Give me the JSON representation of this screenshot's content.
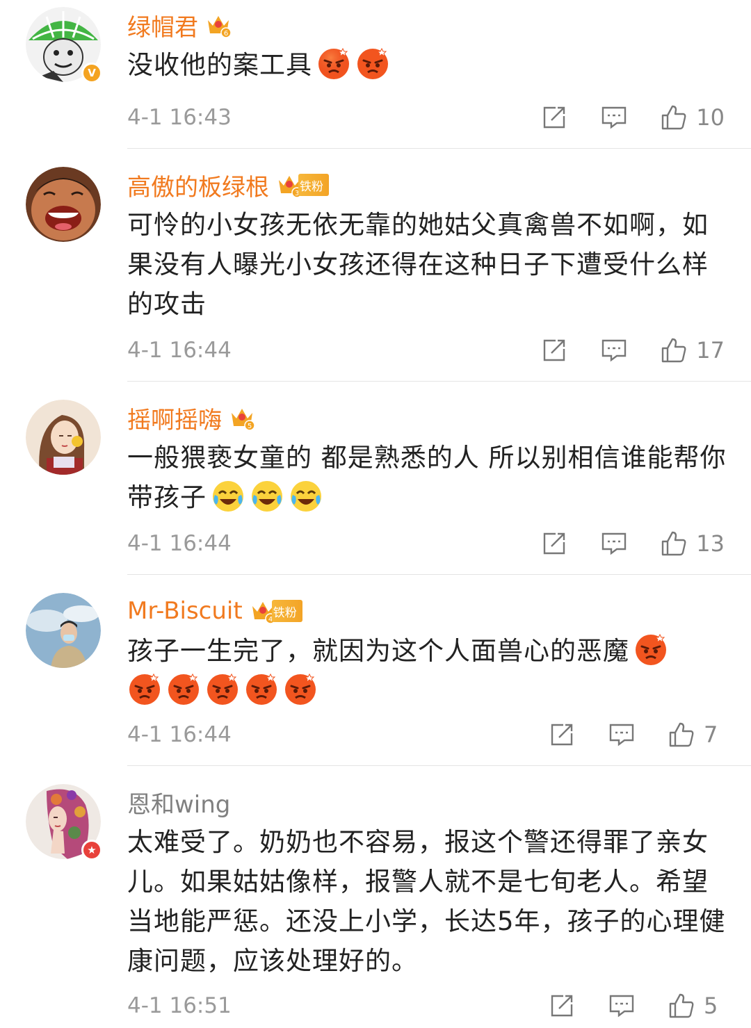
{
  "comments": [
    {
      "username": "绿帽君",
      "crown_level": "6",
      "fan_label": "",
      "text": "没收他的案工具",
      "emoji_count": 2,
      "emoji": "angry-face",
      "time": "4-1 16:43",
      "likes": "10",
      "avatar_badge": "v",
      "avatar_badge_label": "V",
      "avatar_badge_color": "#f4a321"
    },
    {
      "username": "高傲的板绿根",
      "crown_level": "3",
      "fan_label": "铁粉",
      "text": "可怜的小女孩无依无靠的她姑父真禽兽不如啊，如果没有人曝光小女孩还得在这种日子下遭受什么样的攻击",
      "emoji_count": 0,
      "emoji": "",
      "time": "4-1 16:44",
      "likes": "17"
    },
    {
      "username": "摇啊摇嗨",
      "crown_level": "5",
      "fan_label": "",
      "text": "一般猥亵女童的 都是熟悉的人 所以别相信谁能帮你带孩子",
      "emoji_count": 3,
      "emoji": "crying-laughing-face",
      "time": "4-1 16:44",
      "likes": "13"
    },
    {
      "username": "Mr-Biscuit",
      "crown_level": "4",
      "fan_label": "铁粉",
      "text": "孩子一生完了，就因为这个人面兽心的恶魔",
      "emoji_count": 6,
      "emoji": "angry-face",
      "time": "4-1 16:44",
      "likes": "7"
    },
    {
      "username": "恩和wing",
      "crown_level": "",
      "fan_label": "",
      "text": "太难受了。奶奶也不容易，报这个警还得罪了亲女儿。如果姑姑像样，报警人就不是七旬老人。希望当地能严惩。还没上小学，长达5年，孩子的心理健康问题，应该处理好的。",
      "emoji_count": 0,
      "emoji": "",
      "time": "4-1 16:51",
      "likes": "5",
      "avatar_badge": "star",
      "avatar_badge_label": "★",
      "avatar_badge_color": "#e8413b"
    }
  ],
  "icons": {
    "repost": "repost-icon",
    "comment": "comment-icon",
    "like": "thumbs-up-icon"
  },
  "colors": {
    "username_vip": "#f17a1f",
    "username_plain": "#808080",
    "text": "#222222",
    "meta": "#9a9a9a"
  }
}
